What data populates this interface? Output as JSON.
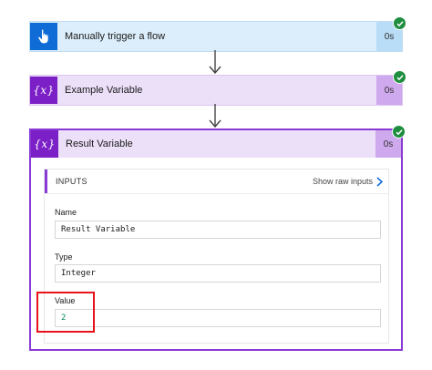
{
  "flow": {
    "steps": [
      {
        "title": "Manually trigger a flow",
        "duration": "0s",
        "status": "succeeded",
        "icon": "touch-hand-icon"
      },
      {
        "title": "Example Variable",
        "duration": "0s",
        "status": "succeeded",
        "icon": "variable-icon"
      },
      {
        "title": "Result Variable",
        "duration": "0s",
        "status": "succeeded",
        "icon": "variable-icon"
      }
    ],
    "variable_icon_text": "{x}",
    "inputs": {
      "title": "INPUTS",
      "raw_link": "Show raw inputs",
      "fields": [
        {
          "label": "Name",
          "value": "Result Variable"
        },
        {
          "label": "Type",
          "value": "Integer"
        },
        {
          "label": "Value",
          "value": "2"
        }
      ]
    }
  },
  "colors": {
    "trigger_accent": "#0f6cd7",
    "variable_accent": "#7b1fc7",
    "success": "#1e8e3e",
    "highlight": "#e8121b"
  }
}
